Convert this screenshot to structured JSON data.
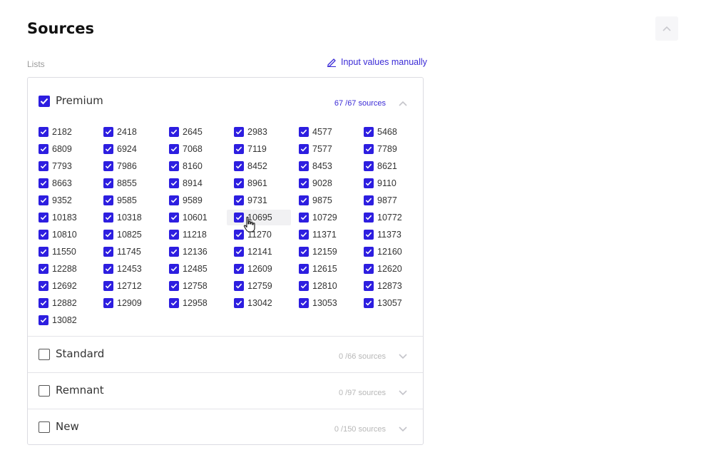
{
  "header": {
    "title": "Sources"
  },
  "lists_label": "Lists",
  "manual_link_label": "Input values manually",
  "groups": [
    {
      "name": "Premium",
      "checked": true,
      "count": "67 /67  sources",
      "expanded": true
    },
    {
      "name": "Standard",
      "checked": false,
      "count": "0 /66 sources",
      "expanded": false
    },
    {
      "name": "Remnant",
      "checked": false,
      "count": "0 /97 sources",
      "expanded": false
    },
    {
      "name": "New",
      "checked": false,
      "count": "0 /150 sources",
      "expanded": false
    }
  ],
  "premium_items": [
    "2182",
    "2418",
    "2645",
    "2983",
    "4577",
    "5468",
    "6809",
    "6924",
    "7068",
    "7119",
    "7577",
    "7789",
    "7793",
    "7986",
    "8160",
    "8452",
    "8453",
    "8621",
    "8663",
    "8855",
    "8914",
    "8961",
    "9028",
    "9110",
    "9352",
    "9585",
    "9589",
    "9731",
    "9875",
    "9877",
    "10183",
    "10318",
    "10601",
    "10695",
    "10729",
    "10772",
    "10810",
    "10825",
    "11218",
    "11270",
    "11371",
    "11373",
    "11550",
    "11745",
    "12136",
    "12141",
    "12159",
    "12160",
    "12288",
    "12453",
    "12485",
    "12609",
    "12615",
    "12620",
    "12692",
    "12712",
    "12758",
    "12759",
    "12810",
    "12873",
    "12882",
    "12909",
    "12958",
    "13042",
    "13053",
    "13057",
    "13082"
  ],
  "colors": {
    "accent": "#2d1ee0",
    "link": "#3b2bd6"
  }
}
